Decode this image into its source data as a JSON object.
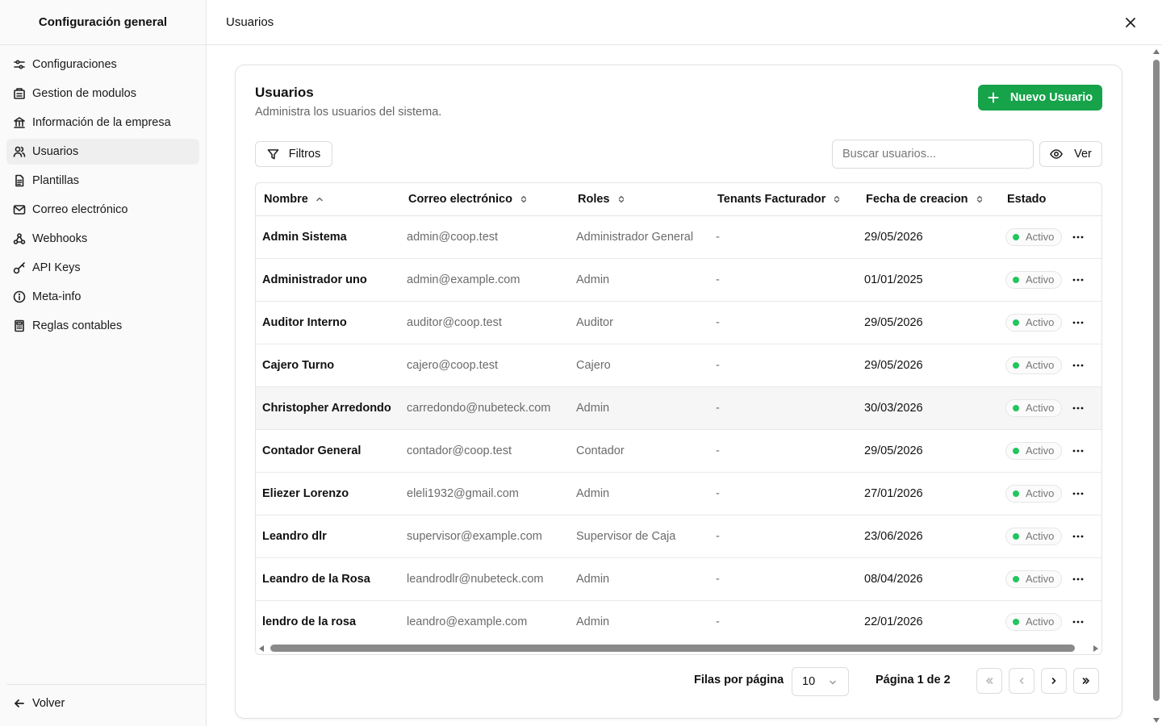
{
  "sidebar": {
    "title": "Configuración general",
    "items": [
      {
        "label": "Configuraciones",
        "icon": "sliders-icon"
      },
      {
        "label": "Gestion de modulos",
        "icon": "modules-icon"
      },
      {
        "label": "Información de la empresa",
        "icon": "bank-icon"
      },
      {
        "label": "Usuarios",
        "icon": "users-icon",
        "active": true
      },
      {
        "label": "Plantillas",
        "icon": "document-icon"
      },
      {
        "label": "Correo electrónico",
        "icon": "mail-icon"
      },
      {
        "label": "Webhooks",
        "icon": "webhook-icon"
      },
      {
        "label": "API Keys",
        "icon": "key-icon"
      },
      {
        "label": "Meta-info",
        "icon": "info-icon"
      },
      {
        "label": "Reglas contables",
        "icon": "calculator-icon"
      }
    ],
    "back_label": "Volver"
  },
  "topbar": {
    "title": "Usuarios"
  },
  "card": {
    "title": "Usuarios",
    "subtitle": "Administra los usuarios del sistema.",
    "new_button": "Nuevo Usuario",
    "filters_button": "Filtros",
    "search_placeholder": "Buscar usuarios...",
    "view_button": "Ver"
  },
  "table": {
    "headers": {
      "name": "Nombre",
      "email": "Correo electrónico",
      "roles": "Roles",
      "tenants": "Tenants Facturador",
      "created": "Fecha de creacion",
      "status": "Estado"
    },
    "rows": [
      {
        "name": "Admin Sistema",
        "email": "admin@coop.test",
        "role": "Administrador General",
        "tenants": "-",
        "created": "29/05/2026",
        "status": "Activo"
      },
      {
        "name": "Administrador uno",
        "email": "admin@example.com",
        "role": "Admin",
        "tenants": "-",
        "created": "01/01/2025",
        "status": "Activo"
      },
      {
        "name": "Auditor Interno",
        "email": "auditor@coop.test",
        "role": "Auditor",
        "tenants": "-",
        "created": "29/05/2026",
        "status": "Activo"
      },
      {
        "name": "Cajero Turno",
        "email": "cajero@coop.test",
        "role": "Cajero",
        "tenants": "-",
        "created": "29/05/2026",
        "status": "Activo"
      },
      {
        "name": "Christopher Arredondo",
        "email": "carredondo@nubeteck.com",
        "role": "Admin",
        "tenants": "-",
        "created": "30/03/2026",
        "status": "Activo"
      },
      {
        "name": "Contador General",
        "email": "contador@coop.test",
        "role": "Contador",
        "tenants": "-",
        "created": "29/05/2026",
        "status": "Activo"
      },
      {
        "name": "Eliezer Lorenzo",
        "email": "eleli1932@gmail.com",
        "role": "Admin",
        "tenants": "-",
        "created": "27/01/2026",
        "status": "Activo"
      },
      {
        "name": "Leandro dlr",
        "email": "supervisor@example.com",
        "role": "Supervisor de Caja",
        "tenants": "-",
        "created": "23/06/2026",
        "status": "Activo"
      },
      {
        "name": "Leandro de la Rosa",
        "email": "leandrodlr@nubeteck.com",
        "role": "Admin",
        "tenants": "-",
        "created": "08/04/2026",
        "status": "Activo"
      },
      {
        "name": "lendro de la rosa",
        "email": "leandro@example.com",
        "role": "Admin",
        "tenants": "-",
        "created": "22/01/2026",
        "status": "Activo"
      }
    ]
  },
  "pagination": {
    "rows_label": "Filas por página",
    "rows_value": "10",
    "page_info": "Página 1 de 2"
  },
  "colors": {
    "accent": "#16a34a",
    "status_dot": "#22c55e"
  }
}
